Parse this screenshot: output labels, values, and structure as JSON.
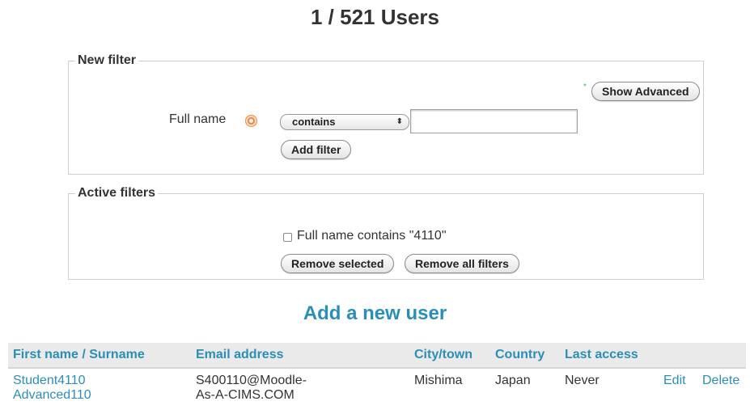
{
  "page": {
    "title": "1 / 521 Users"
  },
  "new_filter": {
    "legend": "New filter",
    "show_advanced_label": "Show Advanced",
    "show_advanced_marker": "*",
    "field_label": "Full name",
    "operator_selected": "contains",
    "value": "",
    "add_filter_label": "Add filter"
  },
  "active_filters": {
    "legend": "Active filters",
    "filter_text": "Full name contains \"4110\"",
    "remove_selected_label": "Remove selected",
    "remove_all_label": "Remove all filters"
  },
  "add_user": {
    "label": "Add a new user"
  },
  "table": {
    "headers": [
      "First name / Surname",
      "Email address",
      "City/town",
      "Country",
      "Last access",
      "",
      ""
    ],
    "rows": [
      {
        "first_name": "Student4110",
        "surname": "Advanced110",
        "email_line1": "S400110@Moodle-",
        "email_line2": "As-A-CIMS.COM",
        "city": "Mishima",
        "country": "Japan",
        "last_access": "Never",
        "edit_label": "Edit",
        "delete_label": "Delete"
      }
    ]
  },
  "colors": {
    "link": "#2a8fb8",
    "header_bg": "#eaeaea",
    "help_icon": "#e8833a",
    "required_marker": "#4caf50"
  },
  "icons": {
    "help": "help-icon",
    "select_arrows": "updown-arrows-icon"
  }
}
